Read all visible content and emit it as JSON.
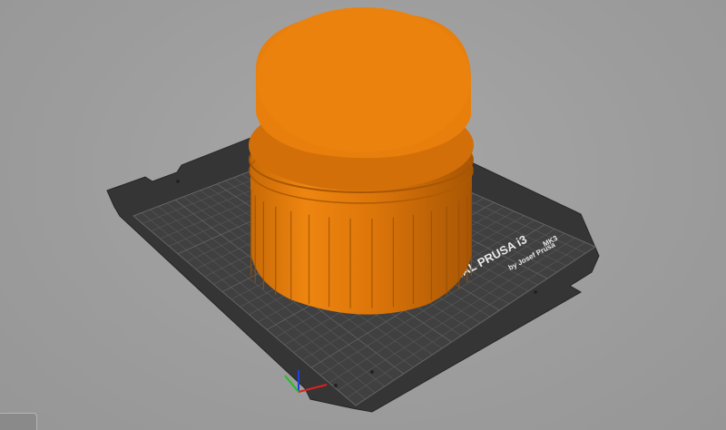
{
  "bed": {
    "brand_line": "ORIGINAL PRUSA i3",
    "model": "MK3",
    "byline": "by Josef Prusa"
  },
  "colors": {
    "background": "#9e9e9e",
    "bed_plate": "#3a3a3a",
    "bed_grid": "#5a5a5a",
    "model_orange": "#e07a0c",
    "model_orange_dark": "#b45f06",
    "axis_x": "#e02020",
    "axis_y": "#20c020",
    "axis_z": "#2040e0"
  },
  "icons": {
    "axes": "xyz-axes-icon",
    "corner": "view-toggle-icon"
  }
}
